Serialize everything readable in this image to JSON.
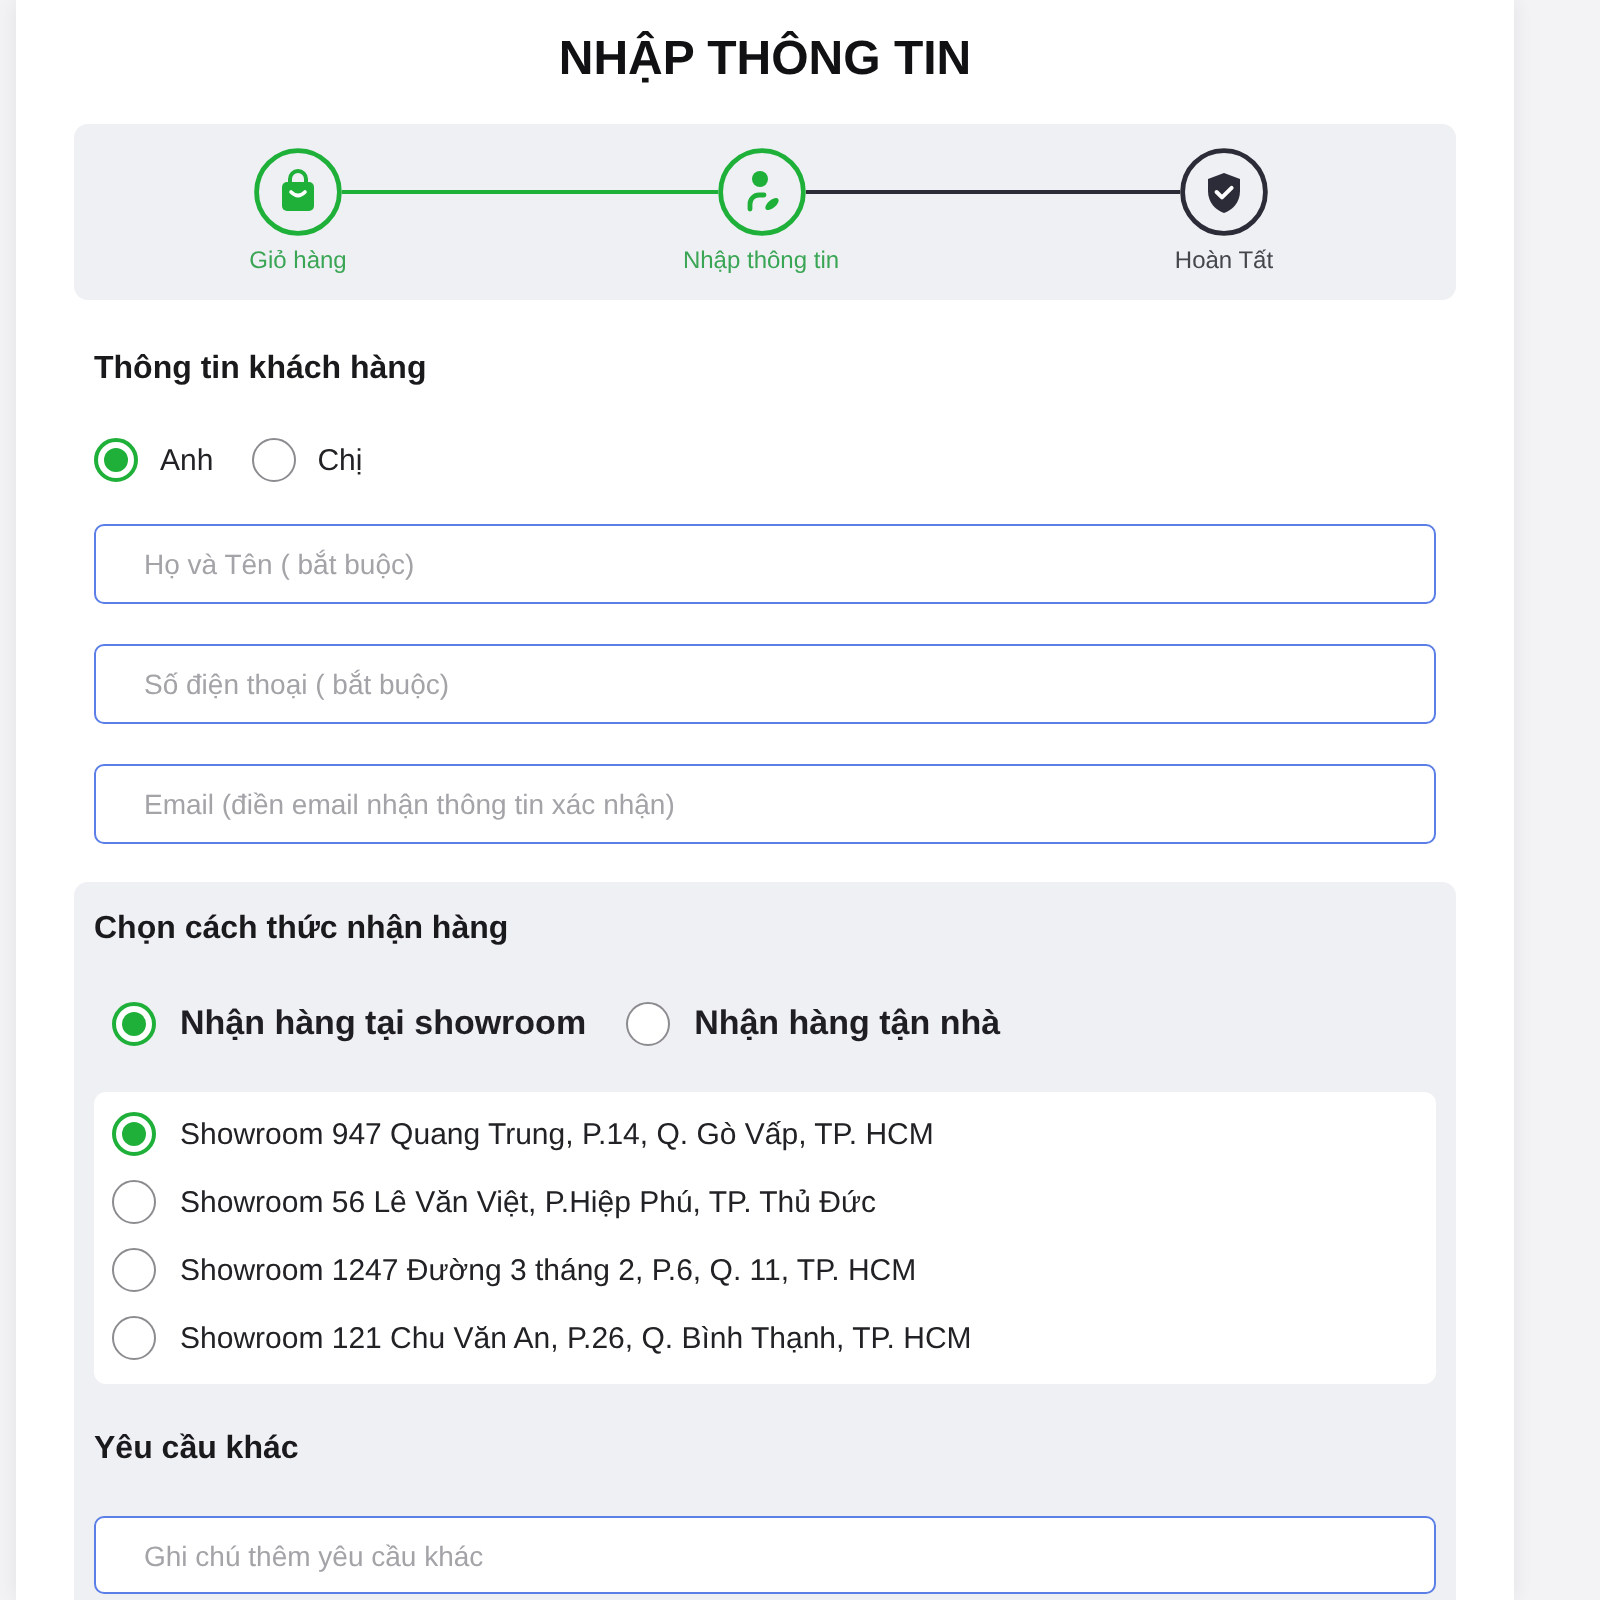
{
  "title": "NHẬP THÔNG TIN",
  "steps": [
    {
      "kind": "cart",
      "label": "Giỏ hàng",
      "active": true
    },
    {
      "kind": "info",
      "label": "Nhập thông tin",
      "active": true
    },
    {
      "kind": "done",
      "label": "Hoàn Tất",
      "active": false
    }
  ],
  "customer": {
    "heading": "Thông tin khách hàng",
    "salutations": [
      {
        "label": "Anh",
        "selected": true
      },
      {
        "label": "Chị",
        "selected": false
      }
    ],
    "fields": [
      {
        "placeholder": "Họ và Tên ( bắt buộc)"
      },
      {
        "placeholder": "Số điện thoại ( bắt buộc)"
      },
      {
        "placeholder": "Email (điền email nhận thông tin xác nhận)"
      }
    ]
  },
  "delivery": {
    "heading": "Chọn cách thức nhận hàng",
    "methods": [
      {
        "label": "Nhận hàng tại showroom",
        "selected": true
      },
      {
        "label": "Nhận hàng tận nhà",
        "selected": false
      }
    ],
    "showrooms": [
      {
        "label": "Showroom 947 Quang Trung, P.14, Q. Gò Vấp, TP. HCM",
        "selected": true
      },
      {
        "label": "Showroom 56 Lê Văn Việt, P.Hiệp Phú, TP. Thủ Đức",
        "selected": false
      },
      {
        "label": "Showroom 1247 Đường 3 tháng 2, P.6, Q. 11, TP. HCM",
        "selected": false
      },
      {
        "label": "Showroom 121 Chu Văn An, P.26, Q. Bình Thạnh, TP. HCM",
        "selected": false
      }
    ],
    "notes": {
      "heading": "Yêu cầu khác",
      "placeholder": "Ghi chú thêm yêu cầu khác"
    }
  }
}
